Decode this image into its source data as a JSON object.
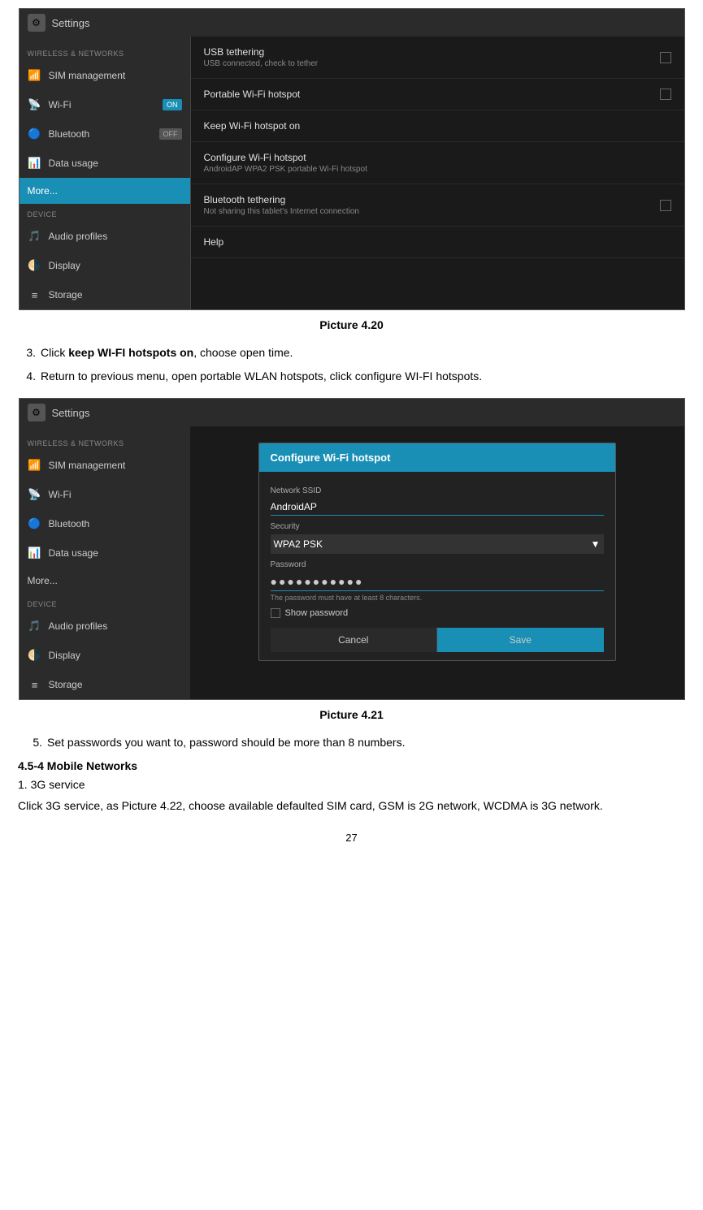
{
  "screenshots": {
    "ss1": {
      "topbar_title": "Settings",
      "sidebar": {
        "section1_label": "WIRELESS & NETWORKS",
        "items": [
          {
            "icon": "📶",
            "label": "SIM management"
          },
          {
            "icon": "📡",
            "label": "Wi-Fi",
            "toggle": "ON",
            "toggle_type": "on"
          },
          {
            "icon": "🔵",
            "label": "Bluetooth",
            "toggle": "OFF",
            "toggle_type": "off"
          },
          {
            "icon": "📊",
            "label": "Data usage"
          },
          {
            "label": "More...",
            "active": true
          }
        ],
        "section2_label": "DEVICE",
        "items2": [
          {
            "icon": "🎵",
            "label": "Audio profiles"
          },
          {
            "icon": "🌗",
            "label": "Display"
          },
          {
            "icon": "≡",
            "label": "Storage"
          }
        ]
      },
      "main_items": [
        {
          "title": "USB tethering",
          "sub": "USB connected, check to tether",
          "has_checkbox": true
        },
        {
          "title": "Portable Wi-Fi hotspot",
          "sub": "",
          "has_checkbox": true
        },
        {
          "title": "Keep Wi-Fi hotspot on",
          "sub": "",
          "has_checkbox": false
        },
        {
          "title": "Configure Wi-Fi hotspot",
          "sub": "AndroidAP WPA2 PSK portable Wi-Fi hotspot",
          "has_checkbox": false
        },
        {
          "title": "Bluetooth tethering",
          "sub": "Not sharing this tablet's Internet connection",
          "has_checkbox": true
        },
        {
          "title": "Help",
          "sub": "",
          "has_checkbox": false
        }
      ]
    },
    "ss2": {
      "topbar_title": "Settings",
      "sidebar": {
        "section1_label": "WIRELESS & NETWORKS",
        "items": [
          {
            "icon": "📶",
            "label": "SIM management"
          },
          {
            "icon": "📡",
            "label": "Wi-Fi"
          },
          {
            "icon": "🔵",
            "label": "Bluetooth"
          },
          {
            "icon": "📊",
            "label": "Data usage"
          },
          {
            "label": "More..."
          }
        ],
        "section2_label": "DEVICE",
        "items2": [
          {
            "icon": "🎵",
            "label": "Audio profiles"
          },
          {
            "icon": "🌗",
            "label": "Display"
          },
          {
            "icon": "≡",
            "label": "Storage"
          }
        ]
      },
      "dialog": {
        "title": "Configure Wi-Fi hotspot",
        "network_ssid_label": "Network SSID",
        "network_ssid_value": "AndroidAP",
        "security_label": "Security",
        "security_value": "WPA2 PSK",
        "password_label": "Password",
        "password_value": "●●●●●●●●●●●",
        "password_hint": "The password must have at least 8 characters.",
        "show_password_label": "Show password",
        "cancel_label": "Cancel",
        "save_label": "Save"
      }
    }
  },
  "caption1": "Picture 4.20",
  "caption2": "Picture 4.21",
  "instructions": [
    {
      "num": "3.",
      "text_before": "Click ",
      "bold_text": "keep WI-FI hotspots on",
      "text_after": ", choose open time."
    },
    {
      "num": "4.",
      "text": "Return to previous menu, open portable WLAN hotspots, click configure WI-FI hotspots."
    }
  ],
  "step5": "Set passwords you want to, password should be more than 8 numbers.",
  "section_title": "4.5-4 Mobile Networks",
  "item1_label": "1. 3G service",
  "body_text": "Click 3G service, as Picture 4.22, choose available defaulted SIM card, GSM is 2G network, WCDMA is 3G network.",
  "page_number": "27"
}
